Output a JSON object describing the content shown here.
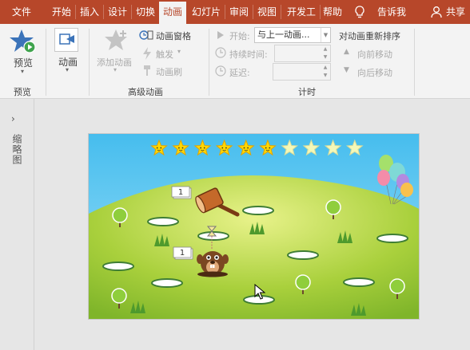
{
  "tabs": [
    {
      "label": "文件",
      "active": false
    },
    {
      "label": "开始",
      "active": false
    },
    {
      "label": "插入",
      "active": false
    },
    {
      "label": "设计",
      "active": false
    },
    {
      "label": "切换",
      "active": false
    },
    {
      "label": "动画",
      "active": true
    },
    {
      "label": "幻灯片放",
      "active": false
    },
    {
      "label": "审阅",
      "active": false
    },
    {
      "label": "视图",
      "active": false
    },
    {
      "label": "开发工具",
      "active": false
    },
    {
      "label": "帮助",
      "active": false
    }
  ],
  "tell_me": "告诉我",
  "share": "共享",
  "ribbon": {
    "preview_label": "预览",
    "preview_group": "预览",
    "animation_label": "动画",
    "add_animation": "添加动画",
    "animation_pane": "动画窗格",
    "trigger": "触发",
    "animation_painter": "动画刷",
    "advanced_group": "高级动画",
    "start_label": "开始:",
    "start_value": "与上一动画...",
    "duration_label": "持续时间:",
    "duration_value": "",
    "delay_label": "延迟:",
    "delay_value": "",
    "timing_group": "计时",
    "reorder_title": "对动画重新排序",
    "move_earlier": "向前移动",
    "move_later": "向后移动"
  },
  "left_pane": {
    "label": "缩略图"
  },
  "slide": {
    "stars_total": 10,
    "stars_filled": 6,
    "tags": [
      {
        "text": "1"
      },
      {
        "text": "1"
      }
    ],
    "colors": {
      "sky": "#5ec7f0",
      "grass": "#9cc936",
      "star_filled": "#ffd800",
      "star_empty": "#f4f8b8"
    }
  },
  "colors": {
    "accent": "#b7472a",
    "ribbon": "#f3f3f3"
  }
}
